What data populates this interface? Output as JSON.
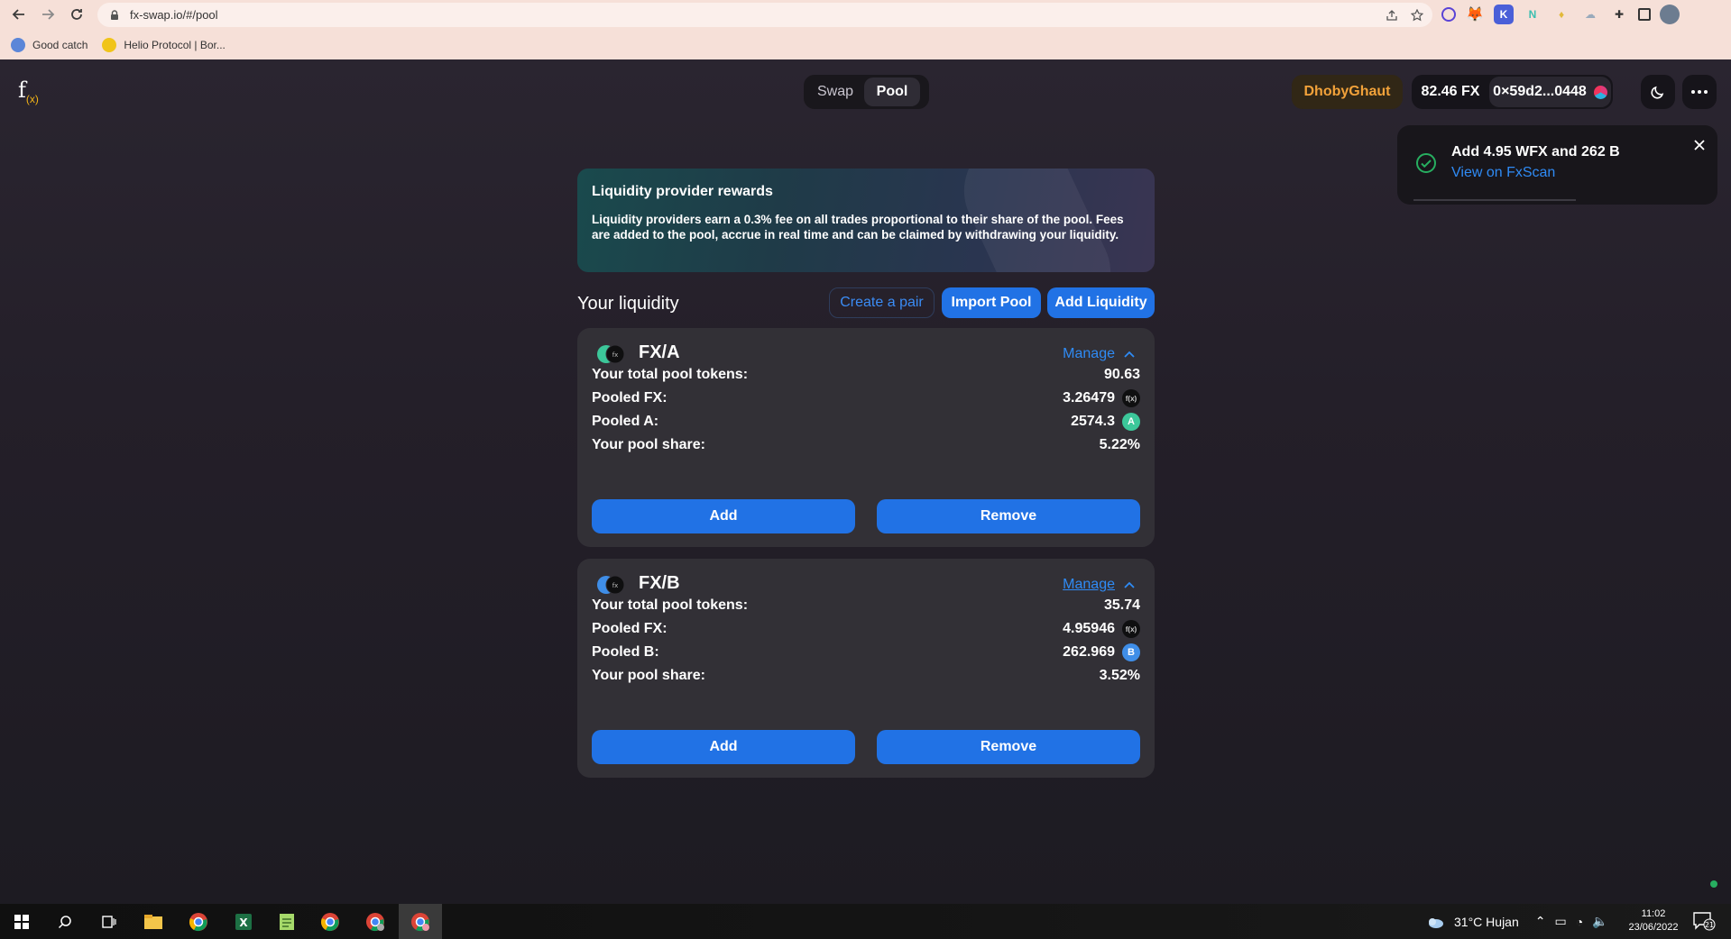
{
  "browser": {
    "url": "fx-swap.io/#/pool",
    "bookmarks": [
      {
        "label": "Good catch"
      },
      {
        "label": "Helio Protocol | Bor..."
      }
    ]
  },
  "app": {
    "logo": "f",
    "logo_sub": "(x)",
    "nav": {
      "swap": "Swap",
      "pool": "Pool",
      "active": "Pool"
    },
    "network": "DhobyGhaut",
    "balance": "82.46 FX",
    "address": "0×59d2...0448"
  },
  "toast": {
    "title": "Add 4.95 WFX and 262 B",
    "link": "View on FxScan"
  },
  "banner": {
    "title": "Liquidity provider rewards",
    "body": "Liquidity providers earn a 0.3% fee on all trades proportional to their share of the pool. Fees are added to the pool, accrue in real time and can be claimed by withdrawing your liquidity."
  },
  "liquidity": {
    "title": "Your liquidity",
    "create_pair": "Create a pair",
    "import_pool": "Import Pool",
    "add_liquidity": "Add Liquidity",
    "pools": [
      {
        "pair": "FX/A",
        "manage": "Manage",
        "rows": [
          {
            "label": "Your total pool tokens:",
            "value": "90.63"
          },
          {
            "label": "Pooled FX:",
            "value": "3.26479",
            "token": "fx"
          },
          {
            "label": "Pooled A:",
            "value": "2574.3",
            "token": "A"
          },
          {
            "label": "Your pool share:",
            "value": "5.22%"
          }
        ],
        "add": "Add",
        "remove": "Remove"
      },
      {
        "pair": "FX/B",
        "manage": "Manage",
        "rows": [
          {
            "label": "Your total pool tokens:",
            "value": "35.74"
          },
          {
            "label": "Pooled FX:",
            "value": "4.95946",
            "token": "fx"
          },
          {
            "label": "Pooled B:",
            "value": "262.969",
            "token": "B"
          },
          {
            "label": "Your pool share:",
            "value": "3.52%"
          }
        ],
        "add": "Add",
        "remove": "Remove"
      }
    ]
  },
  "taskbar": {
    "weather": "31°C  Hujan",
    "time": "11:02",
    "date": "23/06/2022",
    "notifications": "21"
  },
  "colors": {
    "accent": "#2172e5",
    "link": "#2f8bf5",
    "network": "#f2a23a",
    "success": "#27ae60"
  }
}
